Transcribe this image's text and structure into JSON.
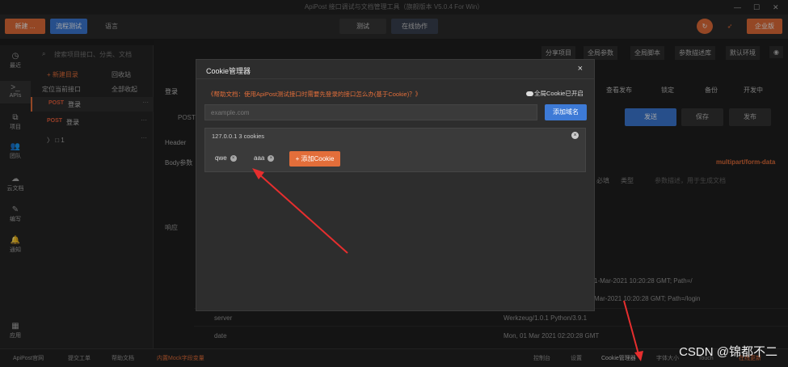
{
  "window": {
    "title": "ApiPost 接口调试与文档管理工具（旗舰版本 V5.0.4 For Win）",
    "min": "—",
    "max": "☐",
    "close": "✕"
  },
  "toolbar": {
    "new_label": "新建 ...",
    "debug_label": "流程测试",
    "lang_label": "语言",
    "env_label": "测试",
    "collab_label": "在线协作",
    "user_label": "企业版"
  },
  "sidebar": {
    "items": [
      {
        "icon": "clock-icon",
        "glyph": "◷",
        "label": "最近"
      },
      {
        "icon": "terminal-icon",
        "glyph": ">_",
        "label": "APIs"
      },
      {
        "icon": "project-icon",
        "glyph": "⧉",
        "label": "项目"
      },
      {
        "icon": "team-icon",
        "glyph": "👥",
        "label": "团队"
      },
      {
        "icon": "cloud-icon",
        "glyph": "☁",
        "label": "云文档"
      },
      {
        "icon": "edit-icon",
        "glyph": "✎",
        "label": "编写"
      },
      {
        "icon": "bell-icon",
        "glyph": "🔔",
        "label": "通知"
      },
      {
        "icon": "grid-icon",
        "glyph": "▦",
        "label": "应用"
      }
    ]
  },
  "tree": {
    "search_placeholder": "搜索项目接口、分类、文档",
    "new_dir": "+ 新建目录",
    "recycle": "回收站",
    "locate": "定位当前接口",
    "collapse": "全部收起",
    "rows": [
      {
        "method": "POST",
        "name": "登录"
      },
      {
        "method": "POST",
        "name": "登录"
      },
      {
        "method": "",
        "name": "〉 □ 1"
      }
    ]
  },
  "main": {
    "share": "分享项目",
    "global_params": "全局参数",
    "global_script": "全局脚本",
    "param_desc": "参数描述库",
    "default_env": "默认环境",
    "tab_login": "登录",
    "method": "POST",
    "check_publish": "查看发布",
    "lock": "锁定",
    "note": "备份",
    "dev_state": "开发中",
    "send": "发送",
    "save": "保存",
    "publish": "发布",
    "header_tab": "Header",
    "body_label": "Body参数",
    "body_type": "multipart/form-data",
    "required": "必填",
    "type": "类型",
    "param_desc_col": "参数描述，用于生成文档",
    "response": "响应",
    "response_rows": [
      {
        "key": "",
        "value": "1-Mar-2021 10:20:28 GMT; Path=/"
      },
      {
        "key": "",
        "value": "Mar-2021 10:20:28 GMT; Path=/login"
      },
      {
        "key": "server",
        "value": "Werkzeug/1.0.1 Python/3.9.1"
      },
      {
        "key": "date",
        "value": "Mon, 01 Mar 2021 02:20:28 GMT"
      }
    ]
  },
  "modal": {
    "title": "Cookie管理器",
    "close": "×",
    "help_text": "《帮助文档：使用ApiPost测试接口时需要先登录的接口怎么办(基于Cookie)？》",
    "global_toggle": "全局Cookie已开启",
    "domain_placeholder": "example.com",
    "add_domain": "添加域名",
    "domain_entry": "127.0.0.1 3 cookies",
    "cookies": [
      "qwe",
      "aaa"
    ],
    "add_cookie": "+ 添加Cookie"
  },
  "statusbar": {
    "items": [
      "ApiPost官网",
      "提交工单",
      "帮助文档",
      "内置Mock字段变量",
      "控制台",
      "设置",
      "Cookie管理器",
      "字体大小",
      "Touch",
      "在线更新"
    ]
  },
  "watermark": "CSDN @锦都不二",
  "colors": {
    "accent_blue": "#3d7ad6",
    "orange": "#e36e3a",
    "post": "#e8603d"
  }
}
